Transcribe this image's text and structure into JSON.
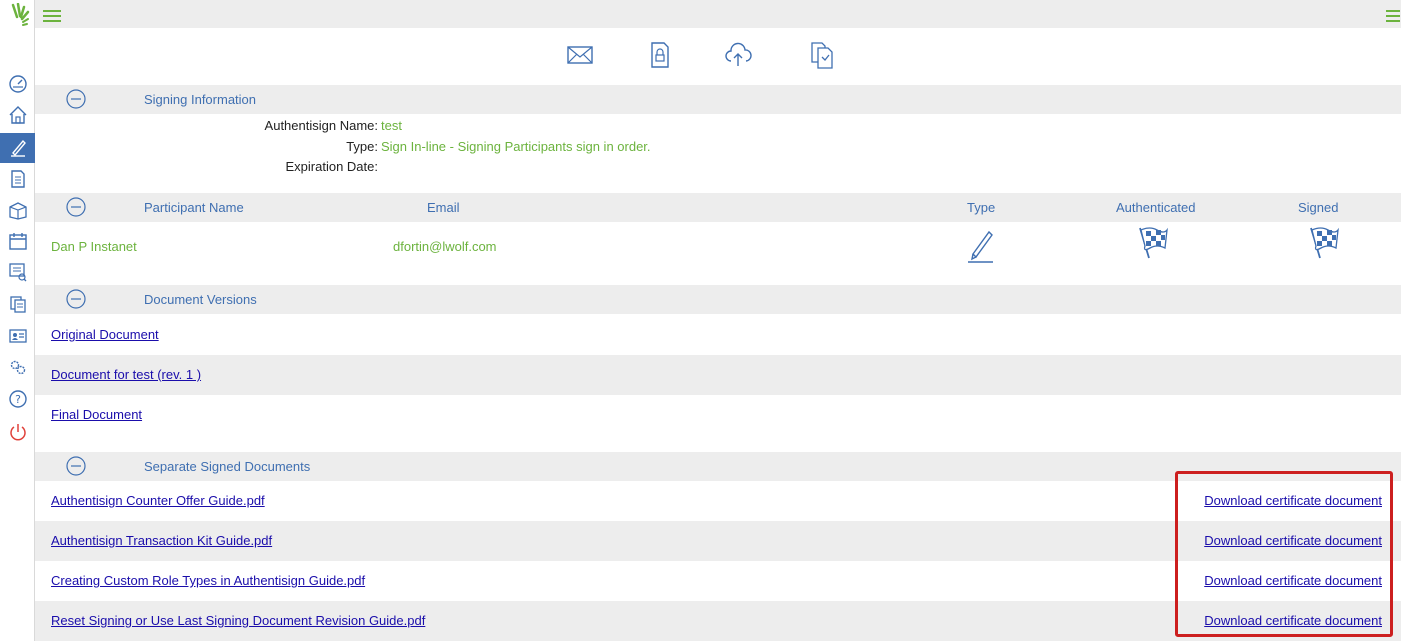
{
  "app": {
    "brand_color": "#6cb33e",
    "accent_color": "#3f6fb1",
    "link_color": "#1a0dab",
    "highlight_color": "#cc1f1f"
  },
  "sidebar": {
    "logo": "authentisign-leaf-logo",
    "items": [
      {
        "icon": "dashboard-gauge-icon"
      },
      {
        "icon": "home-icon"
      },
      {
        "icon": "pen-sign-icon",
        "active": true
      },
      {
        "icon": "document-icon"
      },
      {
        "icon": "package-box-icon"
      },
      {
        "icon": "calendar-icon"
      },
      {
        "icon": "report-search-icon"
      },
      {
        "icon": "documents-copy-icon"
      },
      {
        "icon": "contact-card-icon"
      },
      {
        "icon": "settings-gears-icon"
      },
      {
        "icon": "help-question-icon"
      },
      {
        "icon": "power-logout-icon"
      }
    ]
  },
  "toolbar_icons": [
    "envelope-email-icon",
    "lock-document-icon",
    "cloud-upload-icon",
    "copy-document-icon"
  ],
  "signing_info": {
    "title": "Signing Information",
    "name_label": "Authentisign Name:",
    "name_value": "test",
    "type_label": "Type:",
    "type_value": "Sign In-line - Signing Participants sign in order.",
    "expiration_label": "Expiration Date:",
    "expiration_value": ""
  },
  "participants": {
    "headers": {
      "name": "Participant Name",
      "email": "Email",
      "type": "Type",
      "authenticated": "Authenticated",
      "signed": "Signed"
    },
    "rows": [
      {
        "name": "Dan P Instanet",
        "email": "dfortin@lwolf.com",
        "type_icon": "pen-signer-icon",
        "authenticated_icon": "checkered-flag-icon",
        "signed_icon": "checkered-flag-icon"
      }
    ]
  },
  "document_versions": {
    "title": "Document Versions",
    "items": [
      {
        "label": "Original Document"
      },
      {
        "label": "Document for test (rev. 1 )"
      },
      {
        "label": "Final Document"
      }
    ]
  },
  "separate_signed": {
    "title": "Separate Signed Documents",
    "items": [
      {
        "label": "Authentisign Counter Offer Guide.pdf",
        "cert": "Download certificate document"
      },
      {
        "label": "Authentisign Transaction Kit Guide.pdf",
        "cert": "Download certificate document"
      },
      {
        "label": "Creating Custom Role Types in Authentisign Guide.pdf",
        "cert": "Download certificate document"
      },
      {
        "label": "Reset Signing or Use Last Signing Document Revision Guide.pdf",
        "cert": "Download certificate document"
      }
    ]
  }
}
